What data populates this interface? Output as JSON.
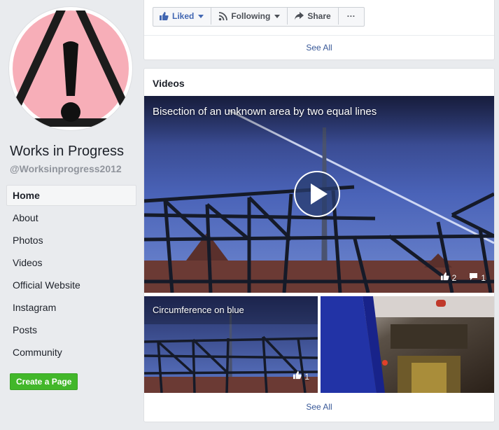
{
  "page": {
    "name": "Works in Progress",
    "handle": "@Worksinprogress2012"
  },
  "nav": {
    "items": [
      {
        "label": "Home"
      },
      {
        "label": "About"
      },
      {
        "label": "Photos"
      },
      {
        "label": "Videos"
      },
      {
        "label": "Official Website"
      },
      {
        "label": "Instagram"
      },
      {
        "label": "Posts"
      },
      {
        "label": "Community"
      }
    ],
    "create_button": "Create a Page"
  },
  "actions": {
    "liked": "Liked",
    "following": "Following",
    "share": "Share",
    "more": "···",
    "see_all": "See All"
  },
  "videos": {
    "title": "Videos",
    "see_all": "See All",
    "main": {
      "title": "Bisection of an unknown area by two equal lines",
      "likes": "2",
      "comments": "1"
    },
    "small": [
      {
        "title": "Circumference on blue",
        "likes": "1"
      },
      {
        "title": ""
      }
    ]
  },
  "icons": {
    "avatar": "warning-sign-icon",
    "liked": "thumbs-up-icon",
    "following": "rss-icon",
    "share": "share-arrow-icon",
    "play": "play-icon",
    "like_count": "thumbs-up-icon",
    "comment_count": "comment-icon"
  },
  "colors": {
    "background": "#e9ebee",
    "link": "#385898",
    "liked_blue": "#4267b2",
    "create_green": "#42b72a",
    "avatar_pink": "#f7aeb8"
  }
}
